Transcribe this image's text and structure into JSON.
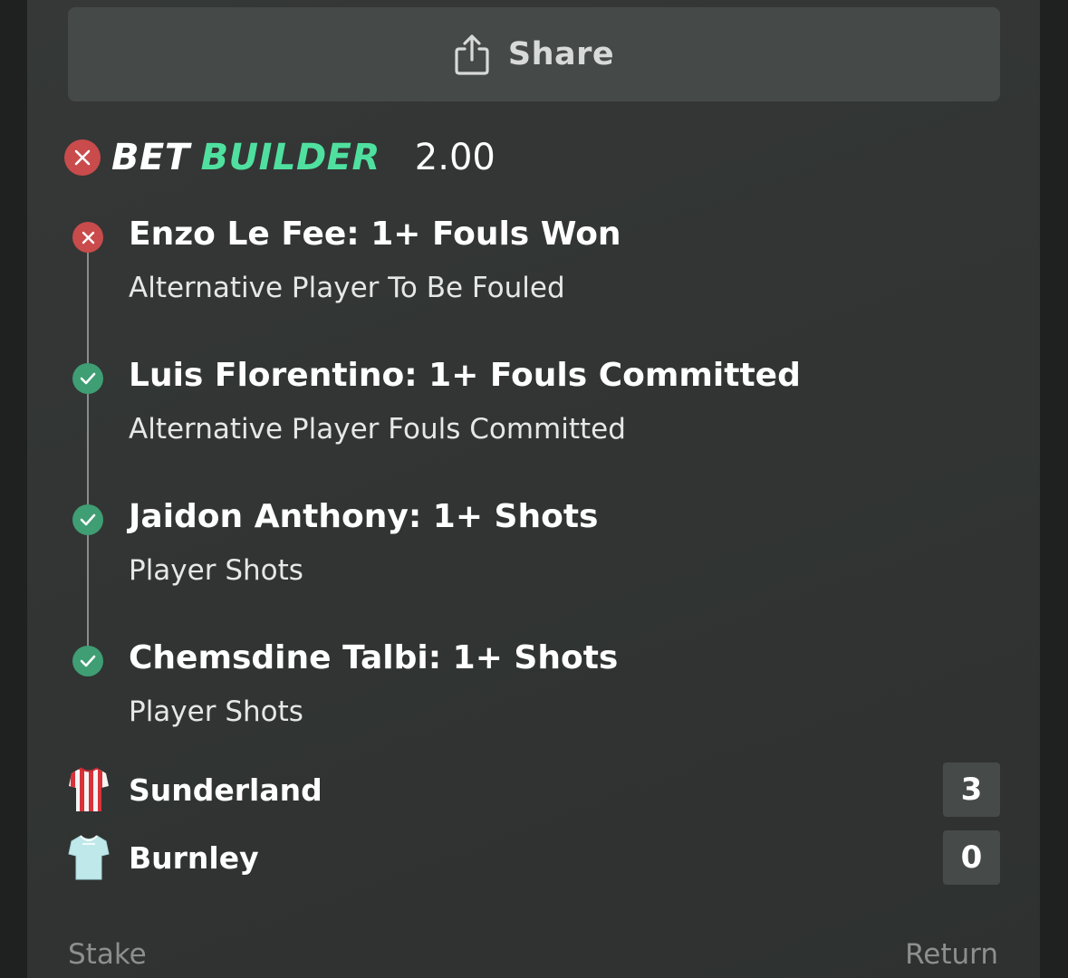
{
  "share": {
    "label": "Share",
    "icon": "share-icon"
  },
  "bet": {
    "status": "lost",
    "title_part1": "BET",
    "title_part2": "BUILDER",
    "odds": "2.00",
    "colors": {
      "accent": "#4fe0a0",
      "lost": "#c94b4b",
      "won": "#3f9e73"
    }
  },
  "legs": [
    {
      "title": "Enzo Le Fee: 1+ Fouls Won",
      "market": "Alternative Player To Be Fouled",
      "status": "lost"
    },
    {
      "title": "Luis Florentino: 1+ Fouls Committed",
      "market": "Alternative Player Fouls Committed",
      "status": "won"
    },
    {
      "title": "Jaidon Anthony: 1+ Shots",
      "market": "Player Shots",
      "status": "won"
    },
    {
      "title": "Chemsdine Talbi: 1+ Shots",
      "market": "Player Shots",
      "status": "won"
    }
  ],
  "match": {
    "home": {
      "name": "Sunderland",
      "score": "3",
      "kit": "red-white-striped-shirt"
    },
    "away": {
      "name": "Burnley",
      "score": "0",
      "kit": "light-blue-shirt"
    }
  },
  "footer": {
    "stake_label": "Stake",
    "return_label": "Return"
  }
}
